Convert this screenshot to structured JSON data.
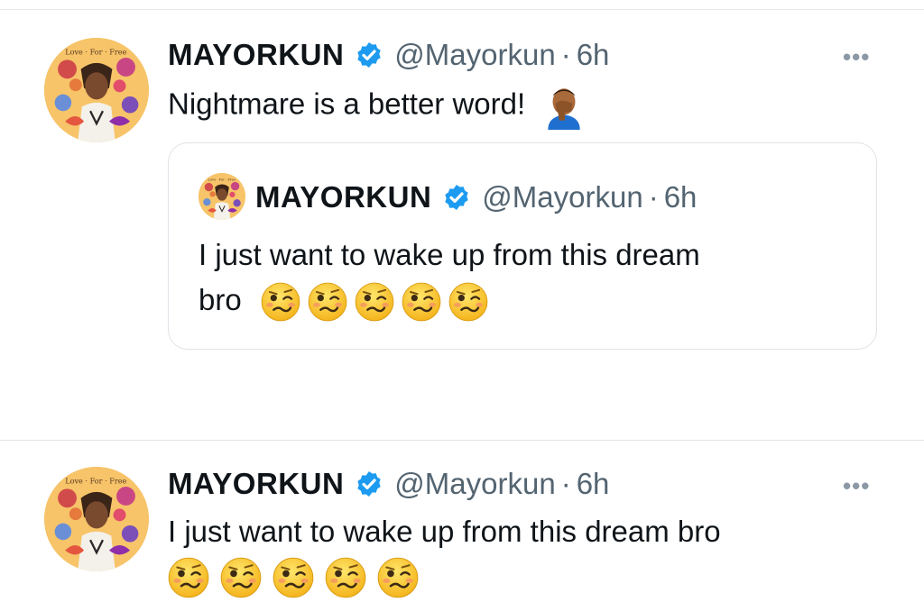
{
  "tweets": [
    {
      "author": {
        "name": "MAYORKUN",
        "handle": "@Mayorkun",
        "time": "6h",
        "separator": "·",
        "verified": true
      },
      "avatar_icon": "album-cover-avatar",
      "text": "Nightmare is a better word!",
      "trailing_emoji": "person-facepalming",
      "more_label": "•••",
      "quote": {
        "author": {
          "name": "MAYORKUN",
          "handle": "@Mayorkun",
          "time": "6h",
          "separator": "·",
          "verified": true
        },
        "line1": "I just want to wake up from this dream",
        "line2": "bro",
        "emojis": [
          "woozy-face",
          "woozy-face",
          "woozy-face",
          "woozy-face",
          "woozy-face"
        ]
      }
    },
    {
      "author": {
        "name": "MAYORKUN",
        "handle": "@Mayorkun",
        "time": "6h",
        "separator": "·",
        "verified": true
      },
      "avatar_icon": "album-cover-avatar",
      "text": "I just want to wake up from this dream bro",
      "more_label": "•••",
      "emojis": [
        "woozy-face",
        "woozy-face",
        "woozy-face",
        "woozy-face",
        "woozy-face"
      ]
    }
  ],
  "colors": {
    "verified": "#1d9bf0",
    "handle": "#536471",
    "text": "#0f1419",
    "border": "#dfe3e7"
  }
}
